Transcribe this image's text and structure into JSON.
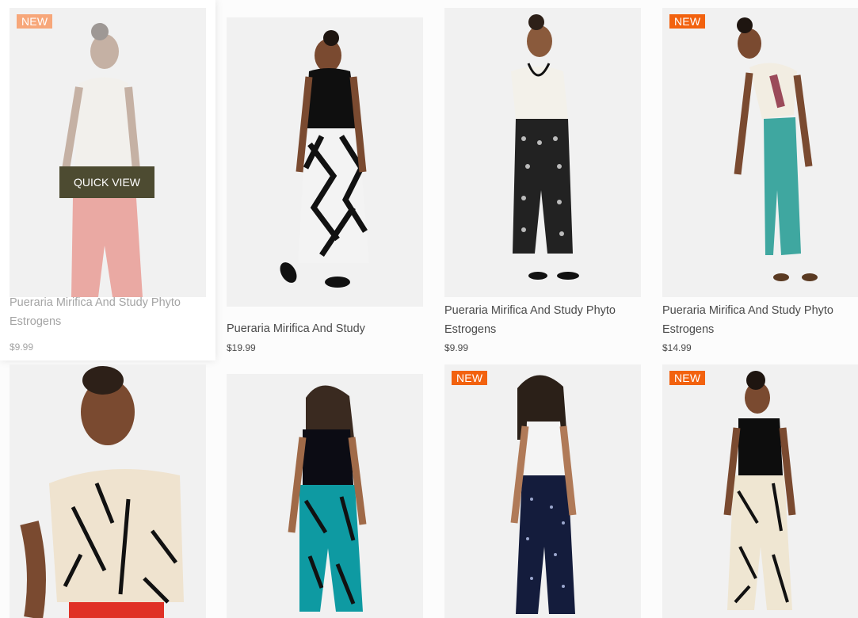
{
  "products": [
    {
      "title": "Pueraria Mirifica And Study Phyto Estrogens",
      "price": "$9.99",
      "badge": "NEW",
      "quick_view": "QUICK VIEW"
    },
    {
      "title": "Pueraria Mirifica And Study",
      "price": "$19.99"
    },
    {
      "title": "Pueraria Mirifica And Study Phyto Estrogens",
      "price": "$9.99"
    },
    {
      "title": "Pueraria Mirifica And Study Phyto Estrogens",
      "price": "$14.99",
      "badge": "NEW"
    },
    {
      "badge": ""
    },
    {
      "badge": ""
    },
    {
      "badge": "NEW"
    },
    {
      "badge": "NEW"
    }
  ],
  "colors": {
    "badge": "#f2620f",
    "quick_view": "#4d4b31",
    "text": "#4a4a4a",
    "muted_text": "#a4a4a4"
  }
}
